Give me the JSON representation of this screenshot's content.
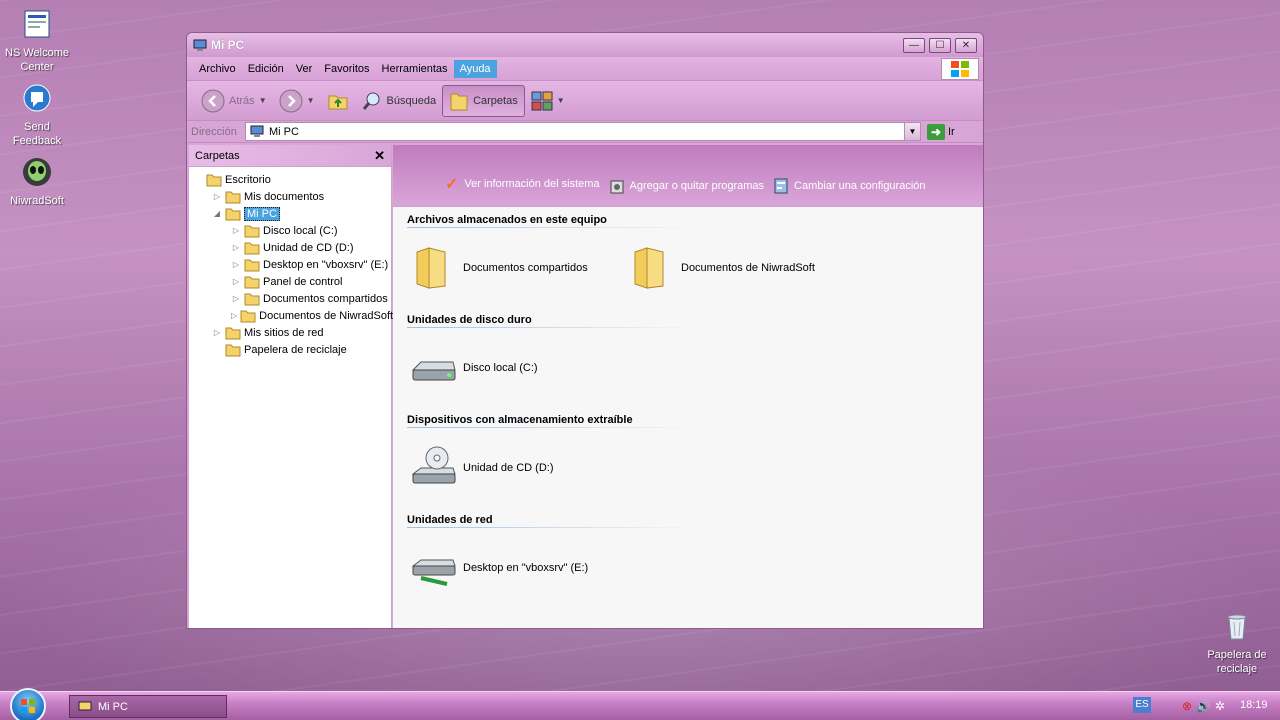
{
  "desktop": {
    "icons": [
      {
        "label": "NS Welcome Center"
      },
      {
        "label": "Send Feedback"
      },
      {
        "label": "NiwradSoft"
      },
      {
        "label": "Papelera de reciclaje"
      }
    ]
  },
  "window": {
    "title": "Mi PC",
    "menu": [
      "Archivo",
      "Edición",
      "Ver",
      "Favoritos",
      "Herramientas",
      "Ayuda"
    ],
    "toolbar": {
      "back": "Atrás",
      "search": "Búsqueda",
      "folders": "Carpetas"
    },
    "address": {
      "label": "Dirección",
      "value": "Mi PC",
      "go": "Ir"
    },
    "folders_pane": {
      "title": "Carpetas",
      "tree": [
        {
          "label": "Escritorio",
          "level": 0,
          "expander": ""
        },
        {
          "label": "Mis documentos",
          "level": 1,
          "expander": "▷"
        },
        {
          "label": "Mi PC",
          "level": 1,
          "expander": "◢",
          "selected": true
        },
        {
          "label": "Disco local (C:)",
          "level": 2,
          "expander": "▷"
        },
        {
          "label": "Unidad de CD (D:)",
          "level": 2,
          "expander": "▷"
        },
        {
          "label": "Desktop en \"vboxsrv\" (E:)",
          "level": 2,
          "expander": "▷"
        },
        {
          "label": "Panel de control",
          "level": 2,
          "expander": "▷"
        },
        {
          "label": "Documentos compartidos",
          "level": 2,
          "expander": "▷"
        },
        {
          "label": "Documentos de NiwradSoft",
          "level": 2,
          "expander": "▷"
        },
        {
          "label": "Mis sitios de red",
          "level": 1,
          "expander": "▷"
        },
        {
          "label": "Papelera de reciclaje",
          "level": 1,
          "expander": ""
        }
      ]
    },
    "tasks": [
      {
        "label": "Ver información del sistema",
        "icon": "checkmark-icon"
      },
      {
        "label": "Agregar o quitar programas",
        "icon": "programs-icon"
      },
      {
        "label": "Cambiar una configuración",
        "icon": "control-panel-icon"
      }
    ],
    "groups": [
      {
        "header": "Archivos almacenados en este equipo",
        "items": [
          {
            "label": "Documentos compartidos",
            "icon": "folder"
          },
          {
            "label": "Documentos de NiwradSoft",
            "icon": "folder"
          }
        ]
      },
      {
        "header": "Unidades de disco duro",
        "items": [
          {
            "label": "Disco local (C:)",
            "icon": "hdd"
          }
        ]
      },
      {
        "header": "Dispositivos con almacenamiento extraíble",
        "items": [
          {
            "label": "Unidad de CD (D:)",
            "icon": "cd"
          }
        ]
      },
      {
        "header": "Unidades de red",
        "items": [
          {
            "label": "Desktop en \"vboxsrv\" (E:)",
            "icon": "net"
          }
        ]
      }
    ]
  },
  "taskbar": {
    "task": "Mi PC",
    "lang": "ES",
    "clock": "18:19"
  }
}
